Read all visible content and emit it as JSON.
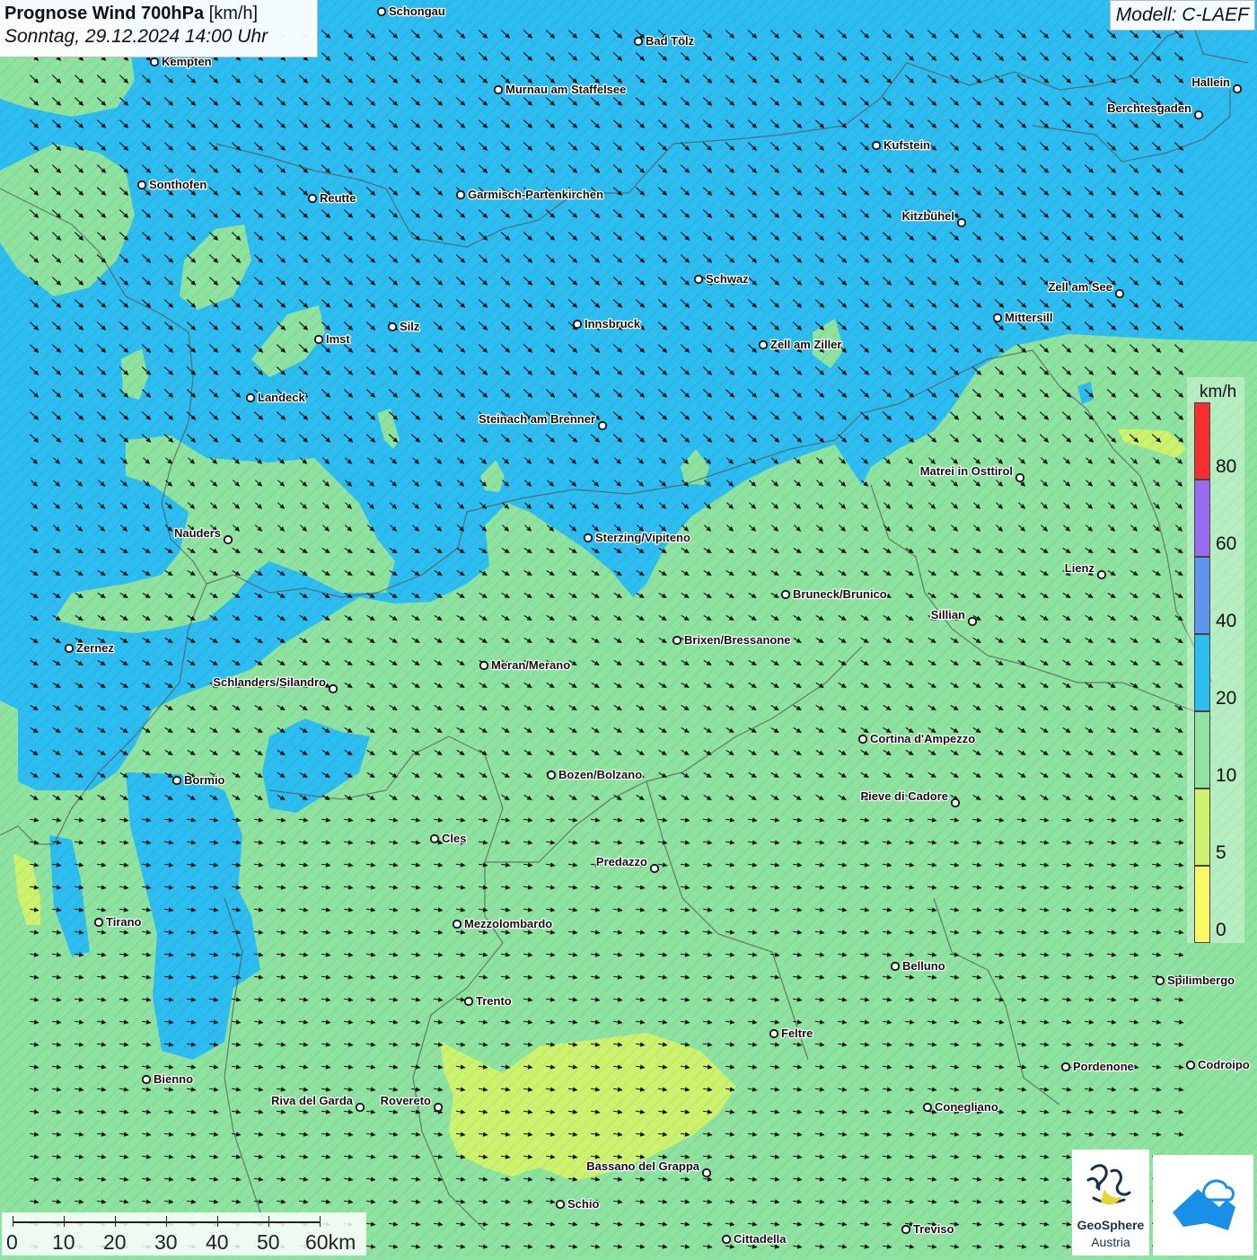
{
  "header": {
    "title_bold": "Prognose Wind 700hPa",
    "title_unit": " [km/h]",
    "datetime": "Sonntag, 29.12.2024 14:00 Uhr",
    "model": "Modell: C-LAEF"
  },
  "legend": {
    "unit": "km/h",
    "items": [
      {
        "label": "80",
        "color": "#f52f2f"
      },
      {
        "label": "60",
        "color": "#9b6bef"
      },
      {
        "label": "40",
        "color": "#5f95ee"
      },
      {
        "label": "20",
        "color": "#2dbdf0"
      },
      {
        "label": "10",
        "color": "#8fe3a0"
      },
      {
        "label": "5",
        "color": "#cdf36e"
      },
      {
        "label": "0",
        "color": "#fbf865"
      }
    ]
  },
  "scalebar": {
    "labels": [
      "0",
      "10",
      "20",
      "30",
      "40",
      "50",
      "60km"
    ]
  },
  "logos": {
    "geosphere_line1": "GeoSphere",
    "geosphere_line2": "Austria"
  },
  "wind_direction": "north-west to south-east",
  "cities": [
    {
      "name": "Schongau",
      "label_side": "right"
    },
    {
      "name": "Bad Tölz",
      "label_side": "right"
    },
    {
      "name": "Kempten",
      "label_side": "right"
    },
    {
      "name": "Murnau am Staffelsee",
      "label_side": "right"
    },
    {
      "name": "Hallein",
      "label_side": "left"
    },
    {
      "name": "Berchtesgaden",
      "label_side": "left"
    },
    {
      "name": "Kufstein",
      "label_side": "right"
    },
    {
      "name": "Sonthofen",
      "label_side": "right"
    },
    {
      "name": "Reutte",
      "label_side": "right"
    },
    {
      "name": "Garmisch-Partenkirchen",
      "label_side": "right"
    },
    {
      "name": "Kitzbühel",
      "label_side": "left"
    },
    {
      "name": "Schwaz",
      "label_side": "right"
    },
    {
      "name": "Zell am See",
      "label_side": "left"
    },
    {
      "name": "Innsbruck",
      "label_side": "right"
    },
    {
      "name": "Mittersill",
      "label_side": "right"
    },
    {
      "name": "Silz",
      "label_side": "right"
    },
    {
      "name": "Imst",
      "label_side": "right"
    },
    {
      "name": "Zell am Ziller",
      "label_side": "right"
    },
    {
      "name": "Landeck",
      "label_side": "right"
    },
    {
      "name": "Steinach am Brenner",
      "label_side": "left"
    },
    {
      "name": "Matrei in Osttirol",
      "label_side": "left"
    },
    {
      "name": "Nauders",
      "label_side": "left"
    },
    {
      "name": "Sterzing/Vipiteno",
      "label_side": "right"
    },
    {
      "name": "Lienz",
      "label_side": "left"
    },
    {
      "name": "Bruneck/Brunico",
      "label_side": "right"
    },
    {
      "name": "Sillian",
      "label_side": "left"
    },
    {
      "name": "Brixen/Bressanone",
      "label_side": "right"
    },
    {
      "name": "Zernez",
      "label_side": "right"
    },
    {
      "name": "Meran/Merano",
      "label_side": "right"
    },
    {
      "name": "Schlanders/Silandro",
      "label_side": "left"
    },
    {
      "name": "Cortina d'Ampezzo",
      "label_side": "right"
    },
    {
      "name": "Bozen/Bolzano",
      "label_side": "right"
    },
    {
      "name": "Pieve di Cadore",
      "label_side": "left"
    },
    {
      "name": "Bormio",
      "label_side": "right"
    },
    {
      "name": "Cles",
      "label_side": "right"
    },
    {
      "name": "Predazzo",
      "label_side": "left"
    },
    {
      "name": "Tirano",
      "label_side": "right"
    },
    {
      "name": "Mezzolombardo",
      "label_side": "right"
    },
    {
      "name": "Belluno",
      "label_side": "right"
    },
    {
      "name": "Spilimbergo",
      "label_side": "right"
    },
    {
      "name": "Trento",
      "label_side": "right"
    },
    {
      "name": "Feltre",
      "label_side": "right"
    },
    {
      "name": "Pordenone",
      "label_side": "right"
    },
    {
      "name": "Codroipo",
      "label_side": "right"
    },
    {
      "name": "Bienno",
      "label_side": "right"
    },
    {
      "name": "Riva del Garda",
      "label_side": "left"
    },
    {
      "name": "Rovereto",
      "label_side": "left"
    },
    {
      "name": "Conegliano",
      "label_side": "right"
    },
    {
      "name": "Bassano del Grappa",
      "label_side": "left"
    },
    {
      "name": "Schio",
      "label_side": "right"
    },
    {
      "name": "Treviso",
      "label_side": "right"
    },
    {
      "name": "Cittadella",
      "label_side": "right"
    }
  ]
}
